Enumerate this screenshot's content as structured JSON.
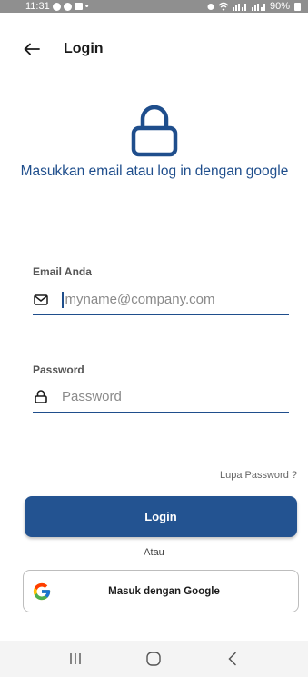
{
  "status_bar": {
    "time": "11:31",
    "extra_dot": "•",
    "battery": "90%"
  },
  "app_bar": {
    "title": "Login"
  },
  "hero": {
    "subtitle": "Masukkan email atau log in dengan google"
  },
  "email": {
    "label": "Email Anda",
    "placeholder": "myname@company.com",
    "value": ""
  },
  "password": {
    "label": "Password",
    "placeholder": "Password",
    "value": ""
  },
  "forgot_label": "Lupa Password ?",
  "login_button_label": "Login",
  "or_label": "Atau",
  "google_button_label": "Masuk dengan Google",
  "colors": {
    "primary": "#235391",
    "heading_blue": "#1f4e8c",
    "status_bar": "#8f8f8f"
  },
  "icons": {
    "back": "arrow-left-icon",
    "hero": "lock-icon",
    "email": "mail-icon",
    "password": "lock-icon",
    "google": "google-logo-icon",
    "nav_recent": "recent-apps-icon",
    "nav_home": "home-icon",
    "nav_back": "chevron-left-icon"
  }
}
